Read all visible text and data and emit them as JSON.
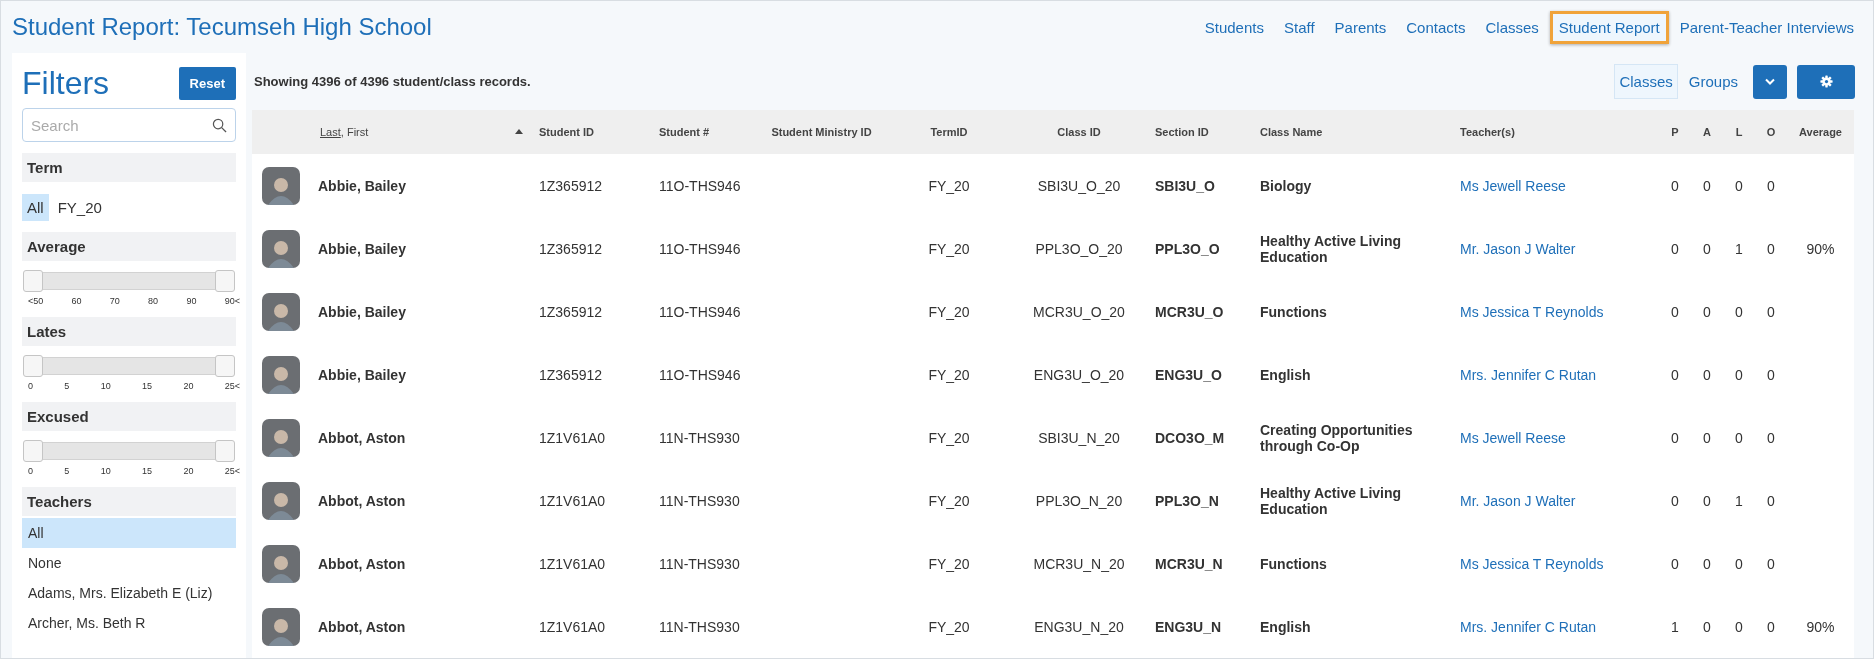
{
  "header": {
    "title": "Student Report: Tecumseh High School"
  },
  "nav": [
    {
      "label": "Students",
      "selected": false
    },
    {
      "label": "Staff",
      "selected": false
    },
    {
      "label": "Parents",
      "selected": false
    },
    {
      "label": "Contacts",
      "selected": false
    },
    {
      "label": "Classes",
      "selected": false
    },
    {
      "label": "Student Report",
      "selected": true
    },
    {
      "label": "Parent-Teacher Interviews",
      "selected": false
    }
  ],
  "filters": {
    "title": "Filters",
    "reset": "Reset",
    "search": {
      "placeholder": "Search"
    },
    "sections": [
      {
        "kind": "chips",
        "title": "Term",
        "options": [
          {
            "label": "All",
            "selected": true
          },
          {
            "label": "FY_20",
            "selected": false
          }
        ]
      },
      {
        "kind": "range",
        "title": "Average",
        "thumbs": [
          {
            "level": 0
          },
          {
            "level": 1
          }
        ],
        "ticks": [
          "<50",
          "60",
          "70",
          "80",
          "90",
          "90<"
        ]
      },
      {
        "kind": "range",
        "title": "Lates",
        "thumbs": [
          {
            "level": 0
          },
          {
            "level": 1
          }
        ],
        "ticks": [
          "0",
          "5",
          "10",
          "15",
          "20",
          "25<"
        ]
      },
      {
        "kind": "range",
        "title": "Excused",
        "thumbs": [
          {
            "level": 0
          },
          {
            "level": 1
          }
        ],
        "ticks": [
          "0",
          "5",
          "10",
          "15",
          "20",
          "25<"
        ]
      },
      {
        "kind": "list",
        "title": "Teachers",
        "options": [
          {
            "label": "All",
            "selected": true
          },
          {
            "label": "None",
            "selected": false
          },
          {
            "label": "Adams, Mrs. Elizabeth E (Liz)",
            "selected": false
          },
          {
            "label": "Archer, Ms. Beth R",
            "selected": false
          }
        ]
      }
    ]
  },
  "summary": "Showing 4396 of 4396 student/class records.",
  "view_tabs": [
    {
      "label": "Classes",
      "selected": true
    },
    {
      "label": "Groups",
      "selected": false
    }
  ],
  "table": {
    "columns": [
      {
        "label": "Last",
        "suffix": ", First",
        "sorted": true
      },
      {
        "label": "Student ID"
      },
      {
        "label": "Student #"
      },
      {
        "label": "Student Ministry ID"
      },
      {
        "label": "TermID"
      },
      {
        "label": "Class ID"
      },
      {
        "label": "Section ID"
      },
      {
        "label": "Class Name"
      },
      {
        "label": "Teacher(s)"
      },
      {
        "label": "P"
      },
      {
        "label": "A"
      },
      {
        "label": "L"
      },
      {
        "label": "O"
      },
      {
        "label": "Average"
      }
    ],
    "rows": [
      {
        "name": "Abbie, Bailey",
        "student_id": "1Z365912",
        "student_no": "11O-THS946",
        "term": "FY_20",
        "class_id": "SBI3U_O_20",
        "section": "SBI3U_O",
        "class_name": "Biology",
        "teacher": "Ms Jewell Reese",
        "p": "0",
        "a": "0",
        "l": "0",
        "o": "0",
        "average": ""
      },
      {
        "name": "Abbie, Bailey",
        "student_id": "1Z365912",
        "student_no": "11O-THS946",
        "term": "FY_20",
        "class_id": "PPL3O_O_20",
        "section": "PPL3O_O",
        "class_name": "Healthy Active Living Education",
        "teacher": "Mr. Jason J Walter",
        "p": "0",
        "a": "0",
        "l": "1",
        "o": "0",
        "average": "90%"
      },
      {
        "name": "Abbie, Bailey",
        "student_id": "1Z365912",
        "student_no": "11O-THS946",
        "term": "FY_20",
        "class_id": "MCR3U_O_20",
        "section": "MCR3U_O",
        "class_name": "Functions",
        "teacher": "Ms Jessica T Reynolds",
        "p": "0",
        "a": "0",
        "l": "0",
        "o": "0",
        "average": ""
      },
      {
        "name": "Abbie, Bailey",
        "student_id": "1Z365912",
        "student_no": "11O-THS946",
        "term": "FY_20",
        "class_id": "ENG3U_O_20",
        "section": "ENG3U_O",
        "class_name": "English",
        "teacher": "Mrs. Jennifer C Rutan",
        "p": "0",
        "a": "0",
        "l": "0",
        "o": "0",
        "average": ""
      },
      {
        "name": "Abbot, Aston",
        "student_id": "1Z1V61A0",
        "student_no": "11N-THS930",
        "term": "FY_20",
        "class_id": "SBI3U_N_20",
        "section": "DCO3O_M",
        "class_name": "Creating Opportunities through Co-Op",
        "teacher": "Ms Jewell Reese",
        "p": "0",
        "a": "0",
        "l": "0",
        "o": "0",
        "average": ""
      },
      {
        "name": "Abbot, Aston",
        "student_id": "1Z1V61A0",
        "student_no": "11N-THS930",
        "term": "FY_20",
        "class_id": "PPL3O_N_20",
        "section": "PPL3O_N",
        "class_name": "Healthy Active Living Education",
        "teacher": "Mr. Jason J Walter",
        "p": "0",
        "a": "0",
        "l": "1",
        "o": "0",
        "average": ""
      },
      {
        "name": "Abbot, Aston",
        "student_id": "1Z1V61A0",
        "student_no": "11N-THS930",
        "term": "FY_20",
        "class_id": "MCR3U_N_20",
        "section": "MCR3U_N",
        "class_name": "Functions",
        "teacher": "Ms Jessica T Reynolds",
        "p": "0",
        "a": "0",
        "l": "0",
        "o": "0",
        "average": ""
      },
      {
        "name": "Abbot, Aston",
        "student_id": "1Z1V61A0",
        "student_no": "11N-THS930",
        "term": "FY_20",
        "class_id": "ENG3U_N_20",
        "section": "ENG3U_N",
        "class_name": "English",
        "teacher": "Mrs. Jennifer C Rutan",
        "p": "1",
        "a": "0",
        "l": "0",
        "o": "0",
        "average": "90%"
      }
    ]
  }
}
